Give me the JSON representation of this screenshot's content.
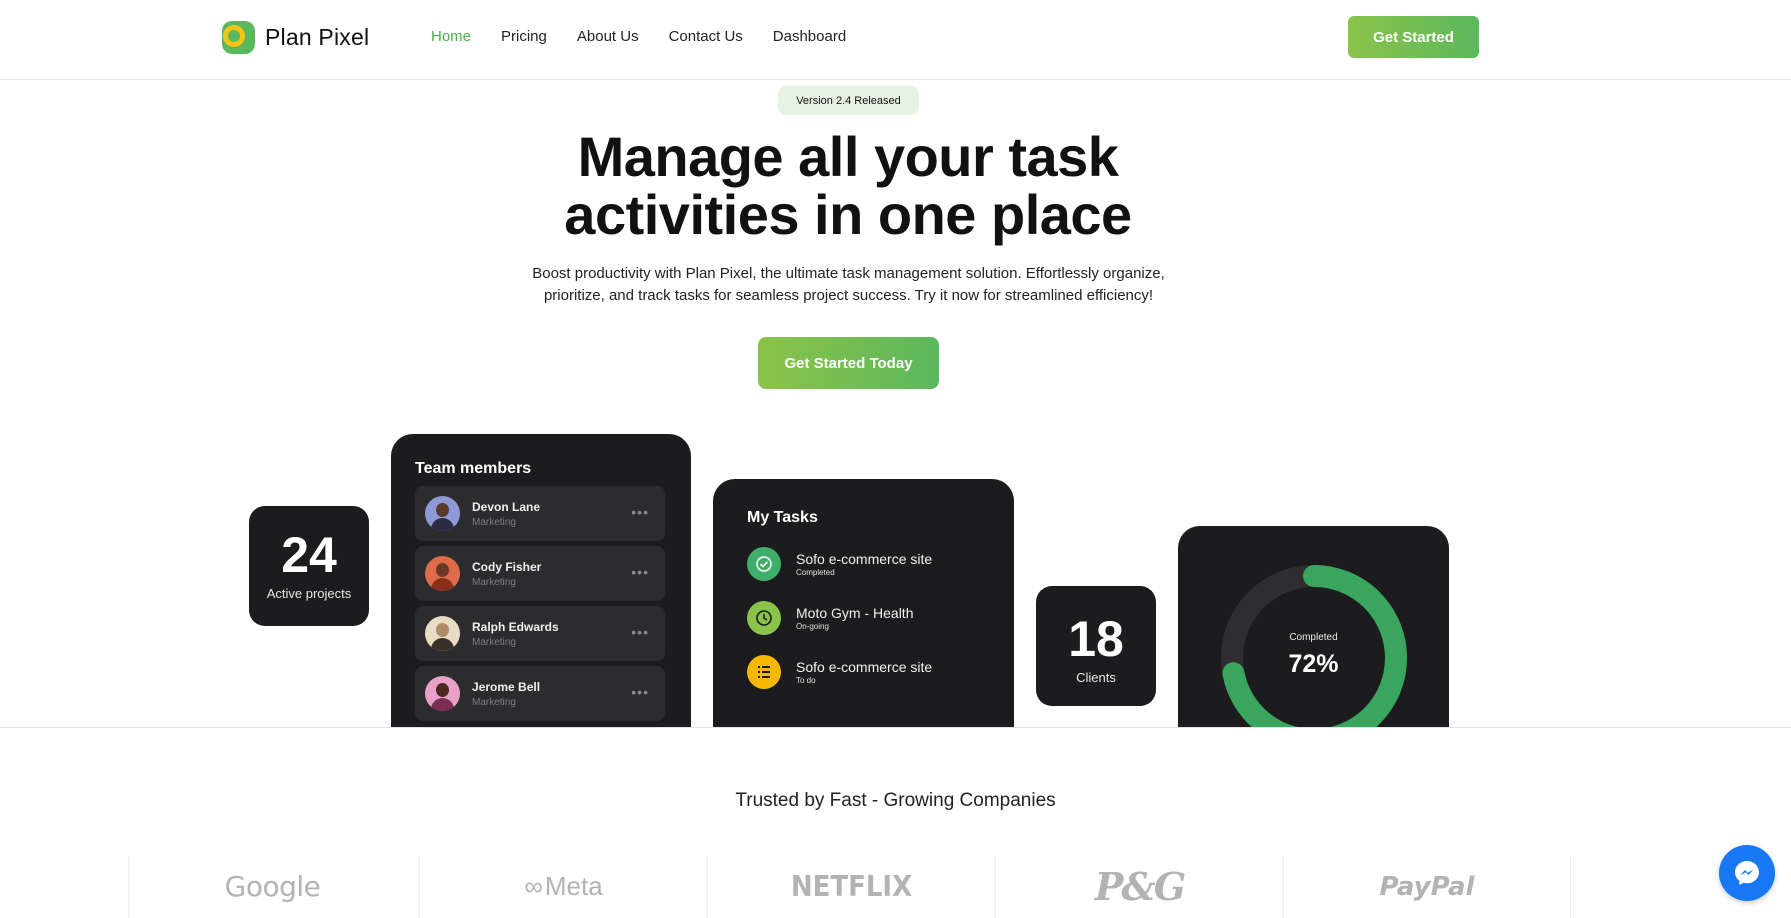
{
  "header": {
    "brand": "Plan Pixel",
    "nav": [
      "Home",
      "Pricing",
      "About Us",
      "Contact Us",
      "Dashboard"
    ],
    "active_nav": "Home",
    "cta": "Get Started"
  },
  "hero": {
    "badge": "Version 2.4 Released",
    "title_line1": "Manage all your task",
    "title_line2": "activities in one place",
    "subtitle": "Boost productivity with Plan Pixel, the ultimate task management solution. Effortlessly organize, prioritize, and track tasks for seamless project success. Try it now for streamlined efficiency!",
    "cta": "Get Started Today"
  },
  "stats": {
    "projects": {
      "value": "24",
      "label": "Active projects"
    },
    "clients": {
      "value": "18",
      "label": "Clients"
    }
  },
  "team": {
    "title": "Team members",
    "members": [
      {
        "name": "Devon Lane",
        "role": "Marketing"
      },
      {
        "name": "Cody Fisher",
        "role": "Marketing"
      },
      {
        "name": "Ralph Edwards",
        "role": "Marketing"
      },
      {
        "name": "Jerome Bell",
        "role": "Marketing"
      }
    ],
    "more_icon": "ellipsis-icon"
  },
  "tasks": {
    "title": "My Tasks",
    "items": [
      {
        "name": "Sofo e-commerce site",
        "status": "Completed",
        "icon": "check-circle-icon"
      },
      {
        "name": "Moto Gym - Health",
        "status": "On-going",
        "icon": "clock-icon"
      },
      {
        "name": "Sofo e-commerce site",
        "status": "To do",
        "icon": "list-icon"
      }
    ]
  },
  "progress": {
    "label": "Completed",
    "value": "72%",
    "fraction": 0.72
  },
  "trusted": {
    "heading": "Trusted by Fast - Growing Companies",
    "logos": [
      "Google",
      "Meta",
      "NETFLIX",
      "P&G",
      "PayPal"
    ]
  },
  "colors": {
    "accent": "#5cb85c",
    "accent_light": "#8bc34a",
    "card_dark": "#1c1c1e",
    "messenger": "#1877f2"
  }
}
